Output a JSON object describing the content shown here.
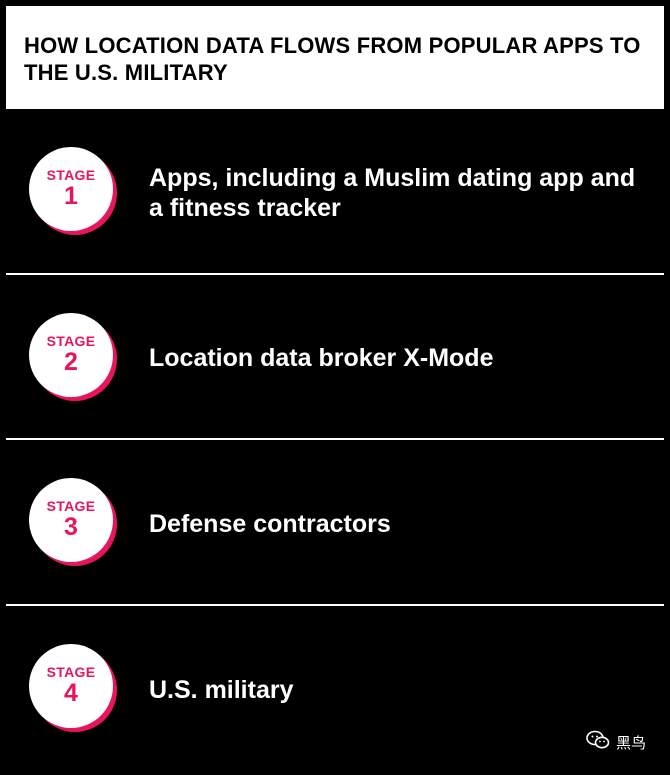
{
  "title": "HOW LOCATION DATA FLOWS FROM POPULAR APPS TO THE U.S. MILITARY",
  "stages": [
    {
      "label": "STAGE",
      "number": "1",
      "text": "Apps, including a Muslim dating app and a fitness tracker"
    },
    {
      "label": "STAGE",
      "number": "2",
      "text": "Location data broker X-Mode"
    },
    {
      "label": "STAGE",
      "number": "3",
      "text": "Defense contractors"
    },
    {
      "label": "STAGE",
      "number": "4",
      "text": "U.S. military"
    }
  ],
  "watermark": {
    "text": "黑鸟",
    "icon": "wechat-icon"
  },
  "colors": {
    "accent": "#e8155a",
    "background": "#000000",
    "header_bg": "#ffffff",
    "text": "#ffffff"
  }
}
